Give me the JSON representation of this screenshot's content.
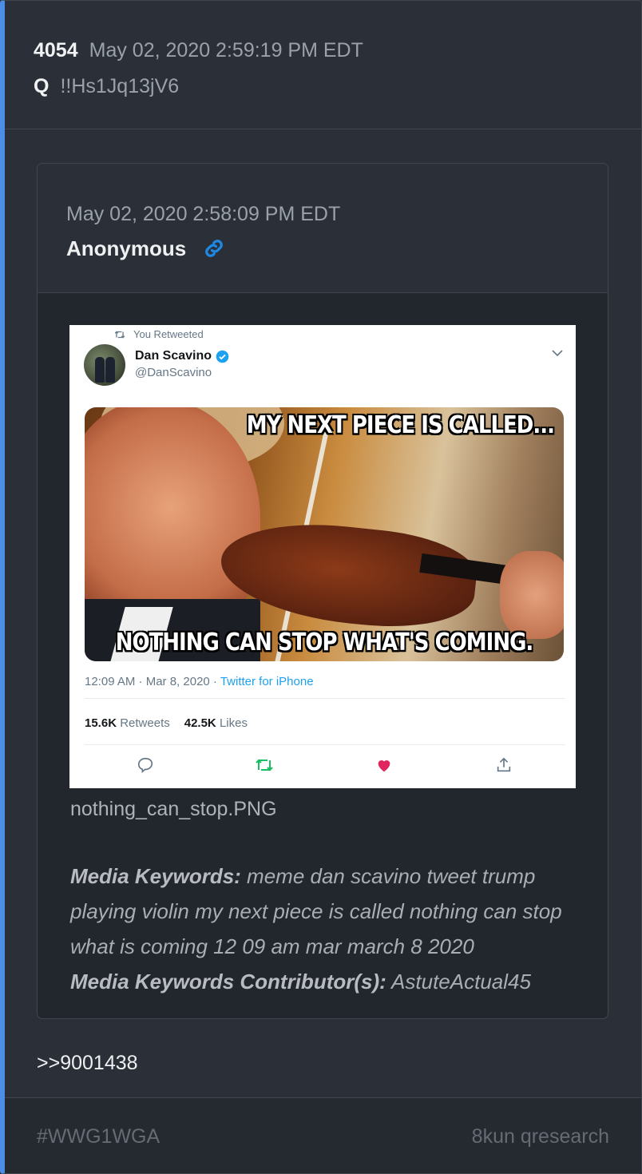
{
  "post": {
    "number": "4054",
    "date": "May 02, 2020 2:59:19 PM EDT",
    "author": "Q",
    "tripcode": "!!Hs1Jq13jV6"
  },
  "quoted": {
    "date": "May 02, 2020 2:58:09 PM EDT",
    "author": "Anonymous",
    "link_icon": "link-icon",
    "image": {
      "retweet_note": "You Retweeted",
      "name": "Dan Scavino",
      "handle": "@DanScavino",
      "meme_top": "MY NEXT PIECE IS CALLED...",
      "meme_bottom": "NOTHING CAN STOP WHAT'S COMING.",
      "time": "12:09 AM · Mar 8, 2020 · ",
      "via": "Twitter for iPhone",
      "retweets_count": "15.6K",
      "retweets_label": "Retweets",
      "likes_count": "42.5K",
      "likes_label": "Likes"
    },
    "filename": "nothing_can_stop.PNG",
    "keywords_label": "Media Keywords:",
    "keywords": " meme dan scavino tweet trump playing violin my next piece is called nothing can stop what is coming 12 09 am mar march 8 2020",
    "contributor_label": "Media Keywords Contributor(s):",
    "contributor": " AstuteActual45"
  },
  "reply_ref": ">>9001438",
  "footer": {
    "hashtag": "#WWG1WGA",
    "source": "8kun qresearch"
  },
  "colors": {
    "accent_bar": "#4c8ee6",
    "background": "#2b3038",
    "link": "#1e88e5"
  }
}
